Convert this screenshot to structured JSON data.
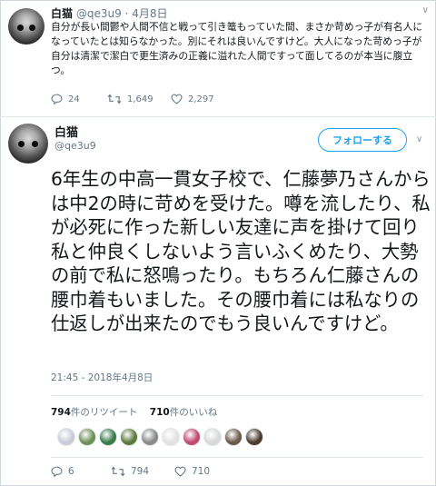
{
  "colors": {
    "blue": "#1da1f2",
    "gray": "#657786",
    "border": "#e1e8ed",
    "text": "#14171a"
  },
  "tweet1": {
    "name": "白猫",
    "handle": "@qe3u9",
    "separator": "·",
    "date": "4月8日",
    "body": "自分が長い間鬱や人間不信と戦って引き篭もっていた間、まさか苛めっ子が有名人になっていたとは知らなかった。別にそれは良いんですけど。大人になった苛めっ子が自分は清潔で潔白で更生済みの正義に溢れた人間ですって面してるのが本当に腹立つ。",
    "replies": "24",
    "retweets": "1,649",
    "likes": "2,297",
    "icons": [
      "reply-icon",
      "retweet-icon",
      "heart-icon",
      "chevron-down-icon"
    ]
  },
  "tweet2": {
    "name": "白猫",
    "handle": "@qe3u9",
    "follow_label": "フォローする",
    "body": "6年生の中高一貫女子校で、仁藤夢乃さんからは中2の時に苛めを受けた。噂を流したり、私が必死に作った新しい友達に声を掛けて回り私と仲良くしないよう言いふくめたり、大勢の前で私に怒鳴ったり。もちろん仁藤さんの腰巾着もいました。その腰巾着には私なりの仕返しが出来たのでもう良いんですけど。",
    "timestamp": "21:45 - 2018年4月8日",
    "retweet_count": "794",
    "retweet_label": "件のリツイート",
    "like_count": "710",
    "like_label": "件のいいね",
    "replies": "6",
    "retweets": "794",
    "likes": "710",
    "liker_avatar_colors": [
      "#c9ccd6",
      "#6e8f58",
      "#3a7a4a",
      "#5d7a3e",
      "#8a8a8a",
      "#e2e2e2",
      "#c04b6d",
      "#d8d8d8",
      "#6a5a48",
      "#4b3b2e"
    ],
    "icons": [
      "reply-icon",
      "retweet-icon",
      "heart-icon",
      "chevron-down-icon"
    ]
  }
}
